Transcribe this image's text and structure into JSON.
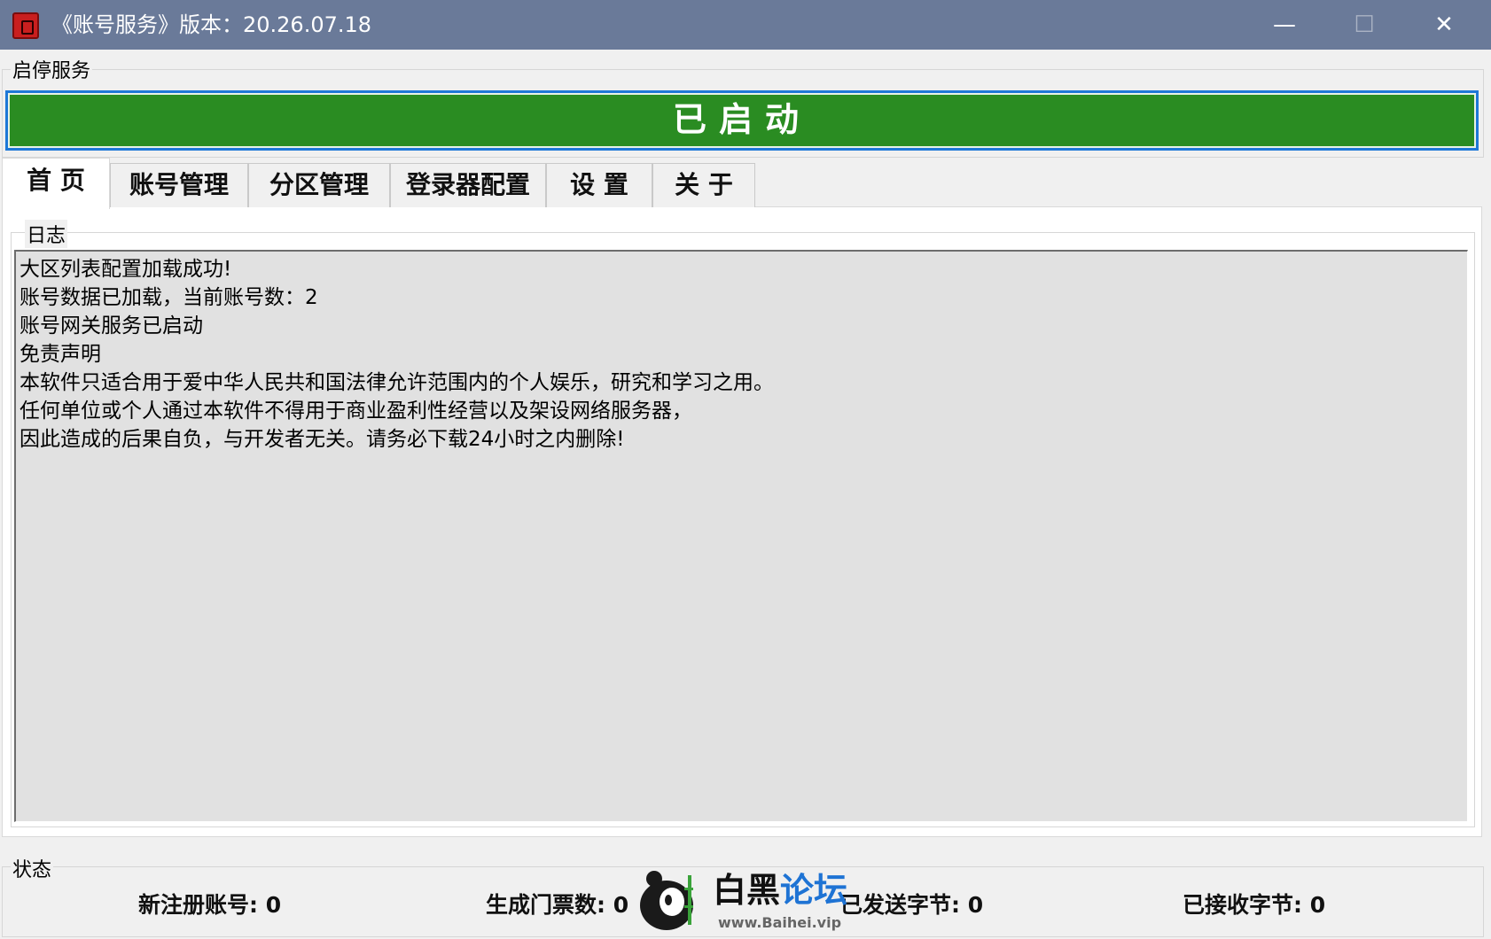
{
  "window": {
    "title": "《账号服务》版本：20.26.07.18",
    "minimize": "—",
    "maximize": "☐",
    "close": "✕"
  },
  "service": {
    "group_label": "启停服务",
    "button_label": "已启动",
    "button_color": "#2a8c22"
  },
  "tabs": [
    {
      "label": "首 页",
      "active": true
    },
    {
      "label": "账号管理",
      "active": false
    },
    {
      "label": "分区管理",
      "active": false
    },
    {
      "label": "登录器配置",
      "active": false
    },
    {
      "label": "设 置",
      "active": false
    },
    {
      "label": "关 于",
      "active": false
    }
  ],
  "log": {
    "group_label": "日志",
    "lines": [
      "大区列表配置加载成功!",
      "账号数据已加载，当前账号数：2",
      "账号网关服务已启动",
      "免责声明",
      "本软件只适合用于爱中华人民共和国法律允许范围内的个人娱乐，研究和学习之用。",
      "任何单位或个人通过本软件不得用于商业盈利性经营以及架设网络服务器，",
      "因此造成的后果自负，与开发者无关。请务必下载24小时之内删除!"
    ]
  },
  "status": {
    "group_label": "状态",
    "new_accounts": "新注册账号: 0",
    "tickets": "生成门票数: 0",
    "bytes_sent": "已发送字节: 0",
    "bytes_received": "已接收字节: 0"
  },
  "watermark": {
    "name_black": "白黑",
    "name_blue": "论坛",
    "url": "www.Baihei.vip"
  }
}
